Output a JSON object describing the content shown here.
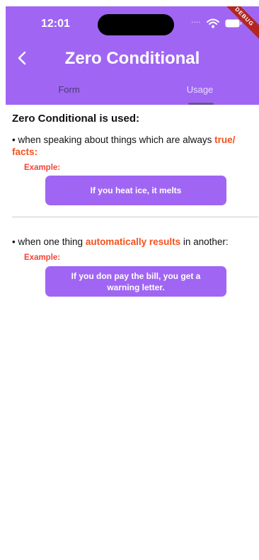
{
  "status_bar": {
    "time": "12:01",
    "signal": "....",
    "debug_label": "DEBUG"
  },
  "app_bar": {
    "title": "Zero Conditional"
  },
  "tabs": [
    {
      "label": "Form",
      "selected": false
    },
    {
      "label": "Usage",
      "selected": true
    }
  ],
  "content": {
    "heading": "Zero Conditional is used:",
    "items": [
      {
        "bullet": "•",
        "text_before": " when speaking about things which are always ",
        "highlight": "true/ facts:",
        "text_after": "",
        "example_label": "Example:",
        "example": "If you heat ice, it melts"
      },
      {
        "bullet": "•",
        "text_before": " when one thing ",
        "highlight": "automatically results",
        "text_after": " in another:",
        "example_label": "Example:",
        "example": "If you don  pay the bill, you get a warning letter."
      }
    ]
  },
  "colors": {
    "primary": "#a066f3",
    "highlight": "#f4511e",
    "example_label": "#f44336"
  }
}
